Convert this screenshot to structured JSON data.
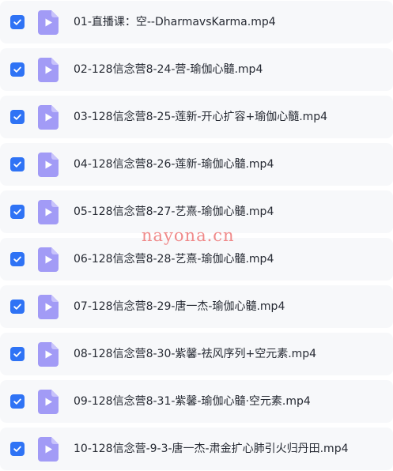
{
  "files": [
    {
      "name": "01-直播课：空--DharmavsKarma.mp4",
      "checked": true
    },
    {
      "name": "02-128信念营8-24-营-瑜伽心髓.mp4",
      "checked": true
    },
    {
      "name": "03-128信念营8-25-莲新-开心扩容+瑜伽心髓.mp4",
      "checked": true
    },
    {
      "name": "04-128信念营8-26-莲新-瑜伽心髓.mp4",
      "checked": true
    },
    {
      "name": "05-128信念营8-27-艺熹-瑜伽心髓.mp4",
      "checked": true
    },
    {
      "name": "06-128信念营8-28-艺熹-瑜伽心髓.mp4",
      "checked": true
    },
    {
      "name": "07-128信念营8-29-唐一杰-瑜伽心髓.mp4",
      "checked": true
    },
    {
      "name": "08-128信念营8-30-紫馨-祛风序列+空元素.mp4",
      "checked": true
    },
    {
      "name": "09-128信念营8-31-紫馨-瑜伽心髓·空元素.mp4",
      "checked": true
    },
    {
      "name": "10-128信念营-9-3-唐一杰-肃金扩心肺引火归丹田.mp4",
      "checked": true
    }
  ],
  "watermark": "nayona.cn",
  "colors": {
    "checkbox": "#2f73f5",
    "file_icon": "#a29bf6",
    "row_background": "#f7f8fa",
    "text": "#262a33",
    "watermark": "#f08a8a"
  },
  "icons": {
    "checkbox": "check-icon",
    "file": "video-file-play-icon"
  }
}
